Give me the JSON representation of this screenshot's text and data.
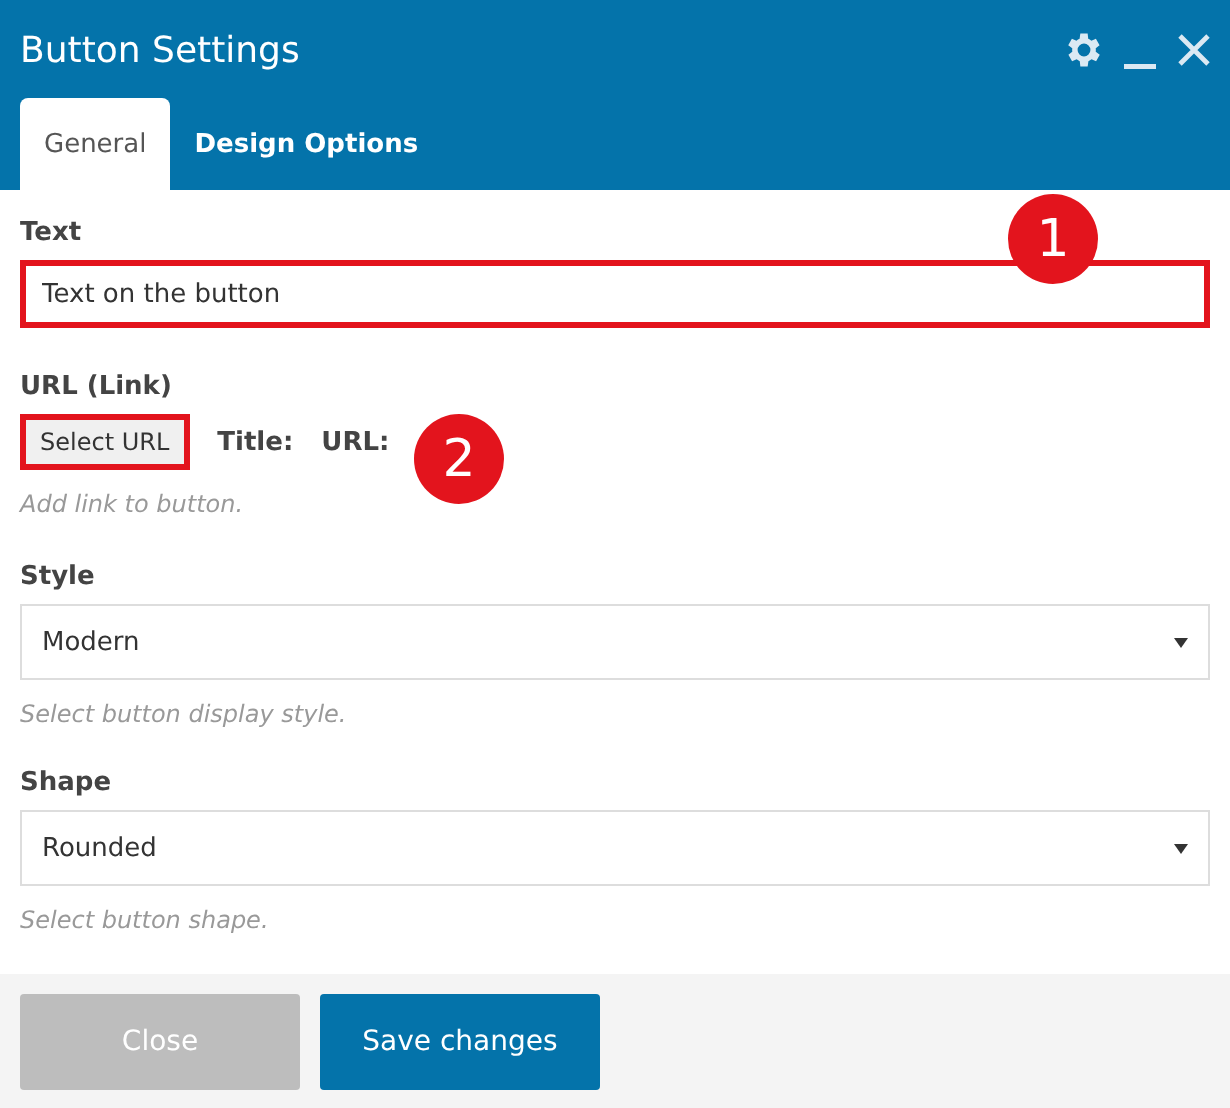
{
  "window": {
    "title": "Button Settings"
  },
  "tabs": [
    {
      "label": "General",
      "selected": true
    },
    {
      "label": "Design Options",
      "selected": false
    }
  ],
  "fields": [
    {
      "kind": "text",
      "label": "Text",
      "value": "Text on the button",
      "highlighted": true
    },
    {
      "kind": "link",
      "label": "URL (Link)",
      "button": "Select URL",
      "highlighted": true,
      "title_label": "Title:",
      "url_label": "URL:",
      "hint": "Add link to button."
    },
    {
      "kind": "select",
      "label": "Style",
      "value": "Modern",
      "hint": "Select button display style."
    },
    {
      "kind": "select",
      "label": "Shape",
      "value": "Rounded",
      "hint": "Select button shape."
    }
  ],
  "annotations": [
    {
      "label": "1"
    },
    {
      "label": "2"
    }
  ],
  "buttons": [
    {
      "label": "Close",
      "kind": "secondary"
    },
    {
      "label": "Save changes",
      "kind": "primary"
    }
  ]
}
